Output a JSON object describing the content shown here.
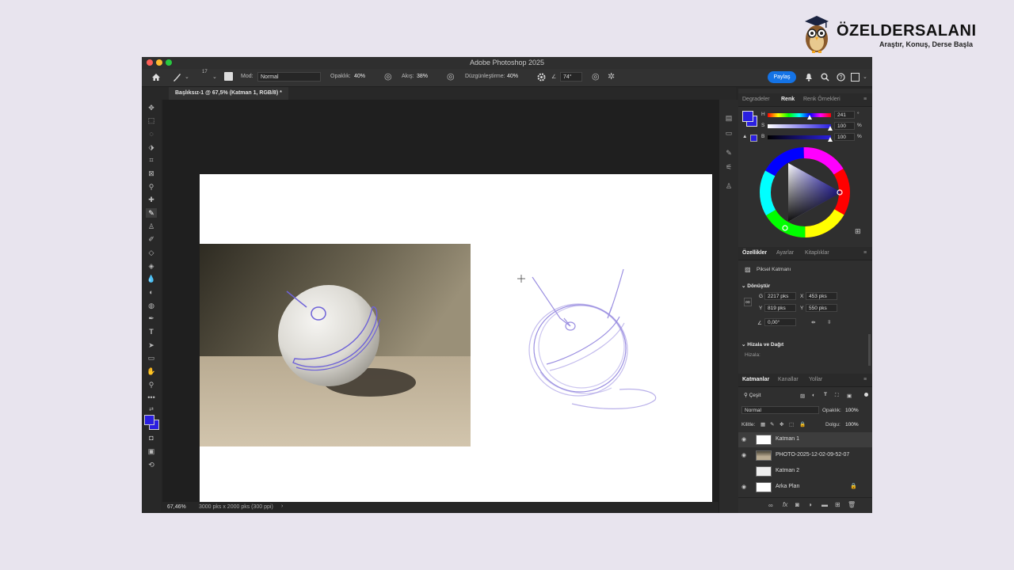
{
  "brand": {
    "name": "ÖZELDERSALANI",
    "tagline": "Araştır, Konuş, Derse Başla"
  },
  "window": {
    "title": "Adobe Photoshop 2025"
  },
  "options": {
    "brush_size": "17",
    "mode_label": "Mod:",
    "mode_value": "Normal",
    "opacity_label": "Opaklık:",
    "opacity_value": "40%",
    "flow_label": "Akış:",
    "flow_value": "38%",
    "smoothing_label": "Düzgünleştirme:",
    "smoothing_value": "40%",
    "angle_value": "74°",
    "share_label": "Paylaş"
  },
  "document": {
    "tab_title": "Başlıksız-1 @ 67,5% (Katman 1, RGB/8) *",
    "zoom": "67,46%",
    "size_info": "3000 pks x 2000 pks (300 ppi)",
    "status_arrow": "›"
  },
  "color_panel": {
    "tabs": [
      "Degradeler",
      "Renk",
      "Renk Örnekleri"
    ],
    "h_label": "H",
    "h_value": "241",
    "h_unit": "°",
    "s_label": "S",
    "s_value": "100",
    "s_unit": "%",
    "b_label": "B",
    "b_value": "100",
    "b_unit": "%"
  },
  "properties_panel": {
    "tabs": [
      "Özellikler",
      "Ayarlar",
      "Kitaplıklar"
    ],
    "layer_type": "Piksel Katmanı",
    "transform_title": "Dönüştür",
    "w_label": "G",
    "w_value": "2217 pks",
    "x_label": "X",
    "x_value": "453 pks",
    "h_label": "Y",
    "h_value": "819 pks",
    "y_label": "Y",
    "y_value": "550 pks",
    "angle_value": "0,00°",
    "align_title": "Hizala ve Dağıt",
    "align_label": "Hizala:"
  },
  "layers_panel": {
    "tabs": [
      "Katmanlar",
      "Kanallar",
      "Yollar"
    ],
    "filter_value": "Çeşit",
    "blend_value": "Normal",
    "opacity_label": "Opaklık:",
    "opacity_value": "100%",
    "lock_label": "Kilitle:",
    "fill_label": "Dolgu:",
    "fill_value": "100%",
    "layers": [
      {
        "name": "Katman 1",
        "visible": true,
        "selected": true
      },
      {
        "name": "PHOTO-2025-12-02-09-52-07",
        "visible": true,
        "selected": false
      },
      {
        "name": "Katman 2",
        "visible": false,
        "selected": false
      },
      {
        "name": "Arka Plan",
        "visible": true,
        "selected": false,
        "locked": true
      }
    ]
  },
  "colors": {
    "accent": "#1473e6",
    "foreground": "#2a1fe0",
    "sketch": "#8878d8"
  },
  "icons": [
    "home-icon",
    "brush-icon",
    "gear-icon",
    "search-icon",
    "help-icon",
    "bell-icon",
    "eye-icon",
    "lock-icon"
  ]
}
